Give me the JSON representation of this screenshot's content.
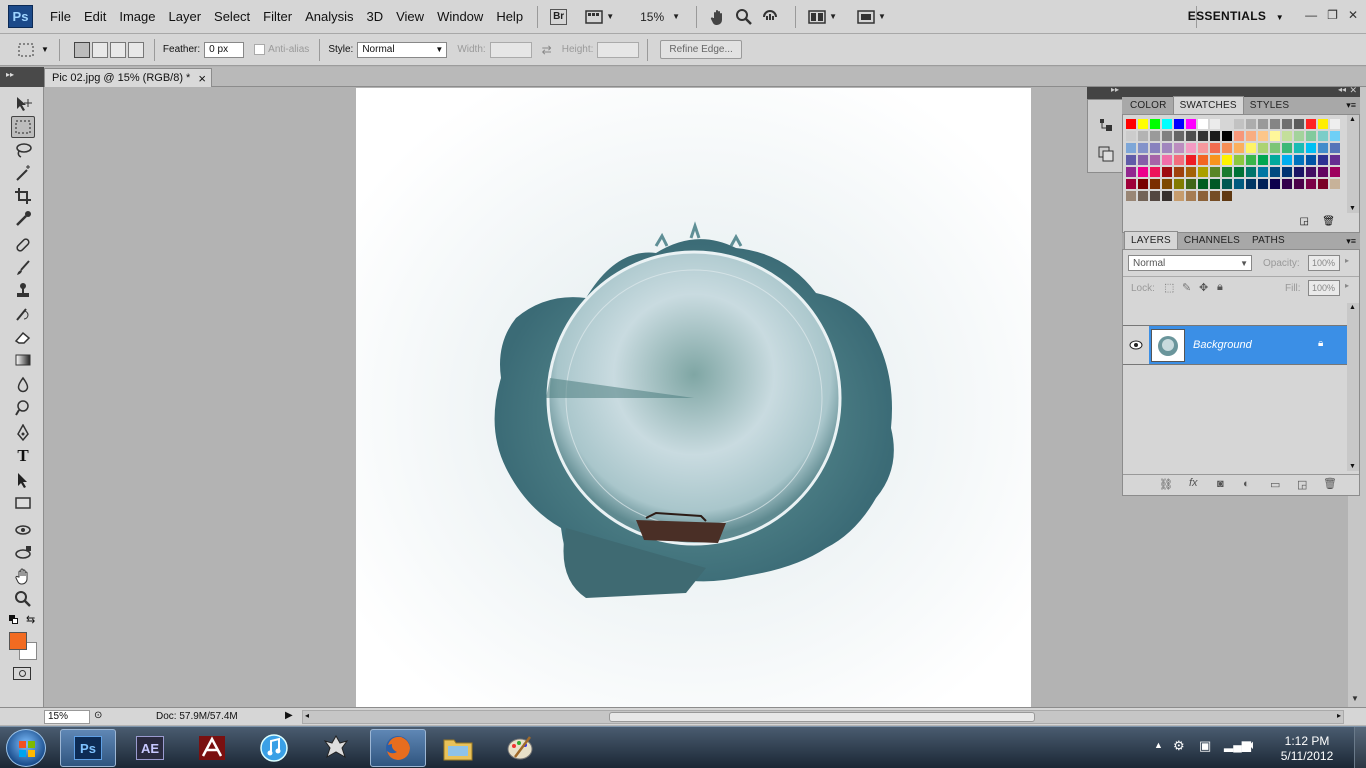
{
  "menubar": {
    "app_logo": "Ps",
    "items": [
      "File",
      "Edit",
      "Image",
      "Layer",
      "Select",
      "Filter",
      "Analysis",
      "3D",
      "View",
      "Window",
      "Help"
    ],
    "bridge_label": "Br",
    "zoom": "15%",
    "workspace": "ESSENTIALS"
  },
  "options": {
    "feather_label": "Feather:",
    "feather_value": "0 px",
    "antialias_label": "Anti-alias",
    "style_label": "Style:",
    "style_value": "Normal",
    "width_label": "Width:",
    "height_label": "Height:",
    "refine_edge": "Refine Edge..."
  },
  "document": {
    "tab_title": "Pic 02.jpg @ 15% (RGB/8) *"
  },
  "statusbar": {
    "zoom": "15%",
    "doc_size": "Doc: 57.9M/57.4M"
  },
  "swatch_panel": {
    "tabs": [
      "COLOR",
      "SWATCHES",
      "STYLES"
    ],
    "active": "SWATCHES"
  },
  "layers_panel": {
    "tabs": [
      "LAYERS",
      "CHANNELS",
      "PATHS"
    ],
    "active": "LAYERS",
    "blend_mode": "Normal",
    "opacity_label": "Opacity:",
    "opacity_value": "100%",
    "lock_label": "Lock:",
    "fill_label": "Fill:",
    "fill_value": "100%",
    "layers": [
      {
        "name": "Background",
        "visible": true,
        "locked": true
      }
    ]
  },
  "colors": {
    "foreground": "#f26b21",
    "background": "#ffffff",
    "selection_blue": "#3b8fe6"
  },
  "taskbar": {
    "time": "1:12 PM",
    "date": "5/11/2012",
    "ps_label": "Ps",
    "ae_label": "AE"
  }
}
